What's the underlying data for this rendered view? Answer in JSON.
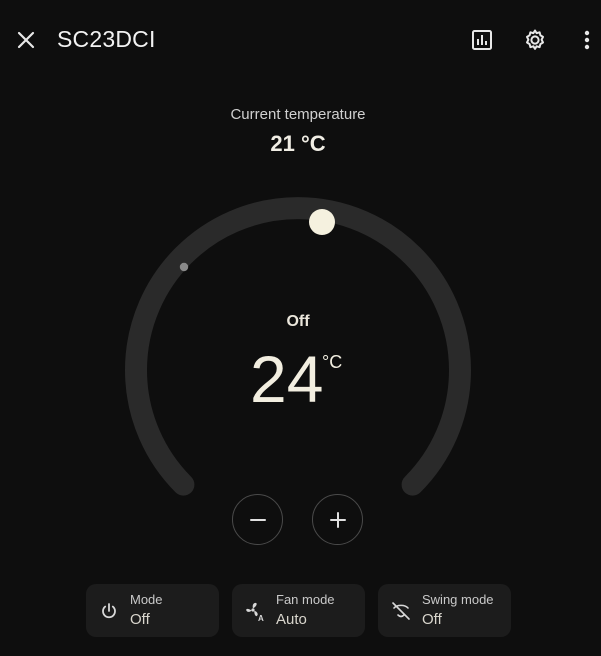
{
  "header": {
    "title": "SC23DCI",
    "icons": [
      "close-icon",
      "chart-icon",
      "gear-icon",
      "more-vert-icon"
    ]
  },
  "current": {
    "label": "Current temperature",
    "value": "21 °C"
  },
  "dial": {
    "hvac_state": "Off",
    "target_temperature": "24",
    "unit": "°C"
  },
  "controls": {
    "decrease_icon": "minus-icon",
    "increase_icon": "plus-icon"
  },
  "tiles": [
    {
      "label": "Mode",
      "value": "Off",
      "icon": "power-icon"
    },
    {
      "label": "Fan mode",
      "value": "Auto",
      "icon": "fan-auto-icon"
    },
    {
      "label": "Swing mode",
      "value": "Off",
      "icon": "swing-off-icon"
    }
  ],
  "colors": {
    "background": "#0e0e0e",
    "track": "#2a2a2a",
    "handle": "#f5f1df",
    "tile_bg": "#1c1c1c"
  }
}
